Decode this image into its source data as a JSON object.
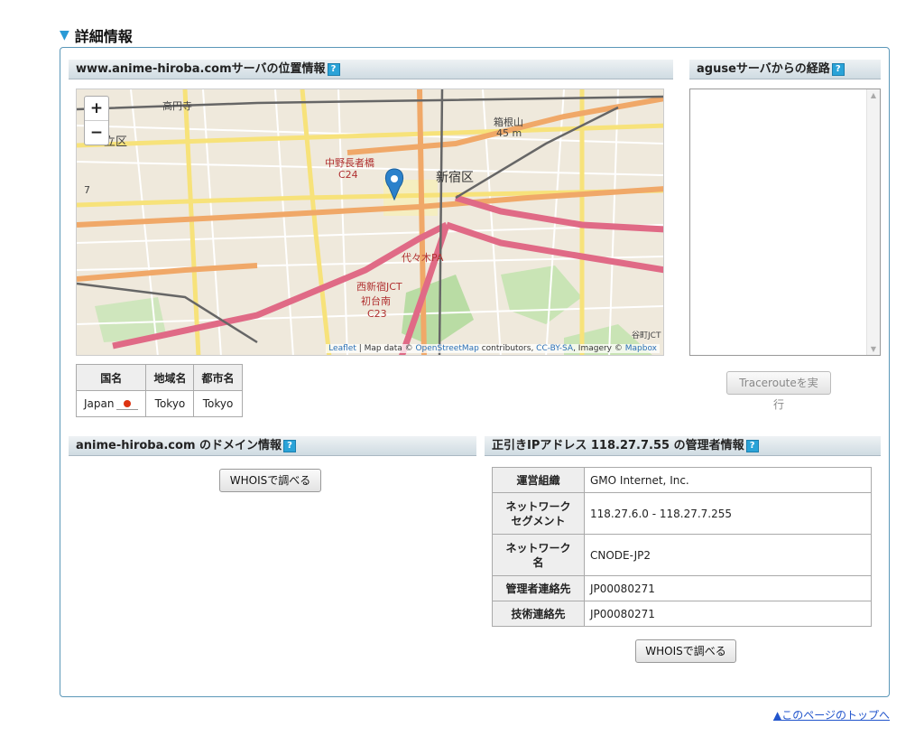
{
  "section": {
    "title": "詳細情報",
    "accent": "#2a9ad6"
  },
  "location": {
    "title": "www.anime-hiroba.comサーバの位置情報",
    "map": {
      "zoom_in": "+",
      "zoom_out": "−",
      "labels": [
        "高円寺",
        "立区",
        "新宿区",
        "中野長者橋",
        "C24",
        "西新宿JCT",
        "初台南",
        "C23",
        "代々木PA",
        "45 m",
        "箱根山",
        "7",
        "谷町JCT"
      ],
      "attribution": {
        "leaflet": "Leaflet",
        "sep1": " | Map data © ",
        "osm": "OpenStreetMap",
        "mid": " contributors, ",
        "license": "CC-BY-SA",
        "imagery": ", Imagery © ",
        "mapbox": "Mapbox"
      }
    },
    "table": {
      "headers": [
        "国名",
        "地域名",
        "都市名"
      ],
      "country": "Japan",
      "region": "Tokyo",
      "city": "Tokyo"
    }
  },
  "route": {
    "title": "aguseサーバからの経路",
    "button": "Tracerouteを実行"
  },
  "domain": {
    "title": "anime-hiroba.com のドメイン情報",
    "button": "WHOISで調べる"
  },
  "ip": {
    "title": "正引きIPアドレス 118.27.7.55 の管理者情報",
    "rows": [
      {
        "label": "運営組織",
        "value": "GMO Internet, Inc."
      },
      {
        "label": "ネットワーク\nセグメント",
        "value": "118.27.6.0 - 118.27.7.255"
      },
      {
        "label": "ネットワーク\n名",
        "value": "CNODE-JP2"
      },
      {
        "label": "管理者連絡先",
        "value": "JP00080271"
      },
      {
        "label": "技術連絡先",
        "value": "JP00080271"
      }
    ],
    "button": "WHOISで調べる"
  },
  "help_icon": "?",
  "footer": {
    "top_link": "▲このページのトップへ"
  }
}
